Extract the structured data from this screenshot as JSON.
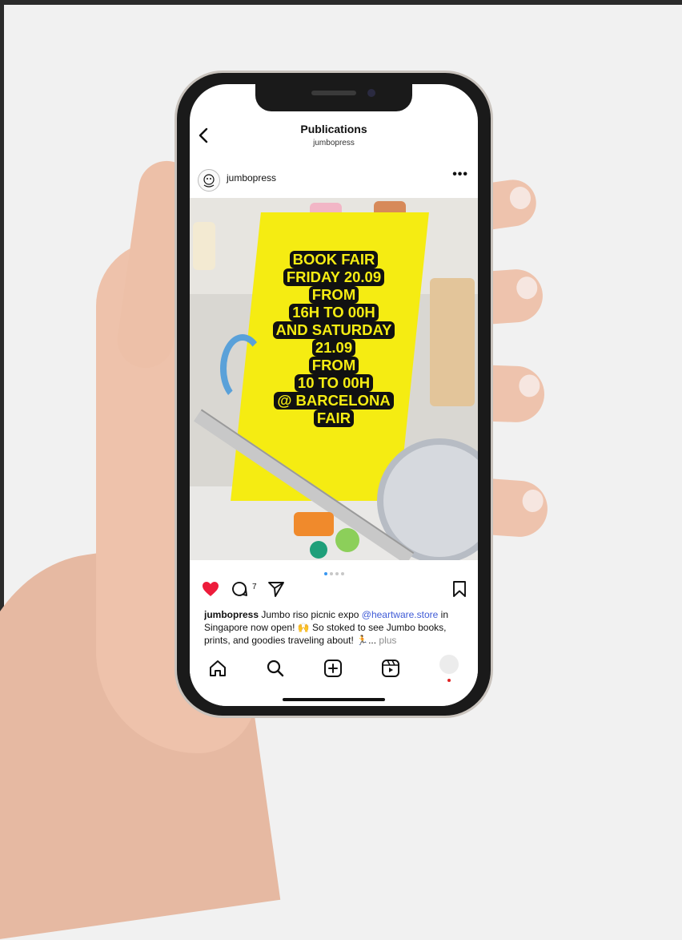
{
  "nav": {
    "back_icon": "chevron-left-icon",
    "title": "Publications",
    "subtitle": "jumbopress"
  },
  "post": {
    "username": "jumbopress",
    "more_icon": "more-horizontal-icon",
    "flyer_lines": [
      "BOOK FAIR",
      "FRIDAY 20.09",
      "FROM",
      "16H TO 00H",
      "AND SATURDAY",
      "21.09",
      "FROM",
      "10 TO 00H",
      "@ BARCELONA",
      "FAIR"
    ],
    "carousel": {
      "total": 4,
      "current": 1
    },
    "liked": true,
    "comment_count": "7",
    "caption": {
      "username": "jumbopress",
      "text_1": "Jumbo riso picnic expo",
      "mention": "@heartware.store",
      "text_2": "in Singapore now open! 🙌 So stoked to see Jumbo books, prints, and goodies traveling about! 🏃...",
      "more": "plus"
    }
  },
  "colors": {
    "like": "#ed1c3b",
    "mention": "#3f5bd6",
    "flyer_bg": "#f5ec12",
    "flyer_text_bg": "#111111"
  },
  "tabbar": {
    "items": [
      "home-icon",
      "search-icon",
      "add-post-icon",
      "reels-icon",
      "profile-avatar"
    ]
  }
}
